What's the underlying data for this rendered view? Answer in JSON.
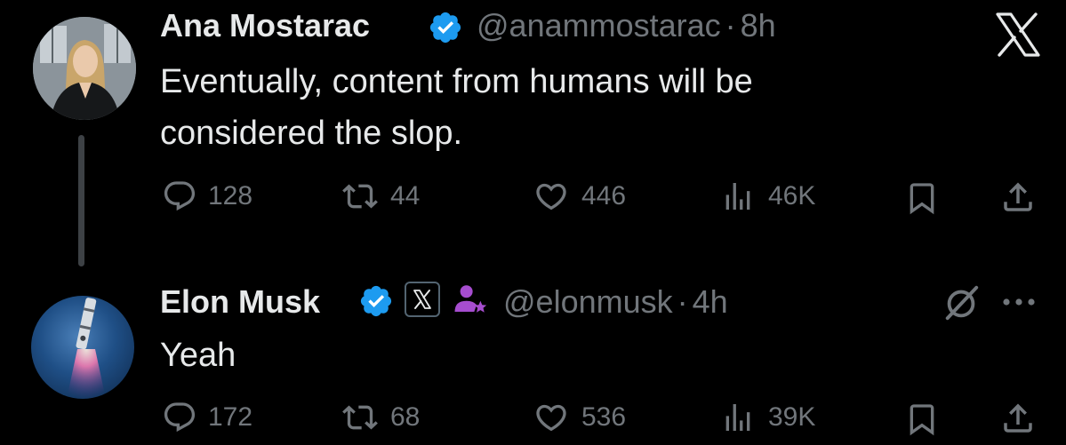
{
  "tweet1": {
    "author": "Ana Mostarac",
    "handle": "@anammostarac",
    "separator": "·",
    "time": "8h",
    "text": "Eventually, content from humans will be considered the slop.",
    "replies": "128",
    "reposts": "44",
    "likes": "446",
    "views": "46K"
  },
  "tweet2": {
    "author": "Elon Musk",
    "handle": "@elonmusk",
    "separator": "·",
    "time": "4h",
    "text": "Yeah",
    "replies": "172",
    "reposts": "68",
    "likes": "536",
    "views": "39K"
  },
  "colors": {
    "background": "#000000",
    "text": "#e7e9ea",
    "muted": "#71767b",
    "verified_blue": "#1d9bf0",
    "affiliate_purple": "#a64dcf",
    "thread_line": "#3d4145"
  },
  "icons": {
    "x_logo": "x-logo-icon",
    "reply": "reply-icon",
    "repost": "repost-icon",
    "like": "heart-icon",
    "views": "views-icon",
    "bookmark": "bookmark-icon",
    "share": "share-icon",
    "verified": "verified-badge-icon",
    "affiliate": "affiliate-badge-icon",
    "grok": "grok-icon",
    "more": "more-icon"
  }
}
